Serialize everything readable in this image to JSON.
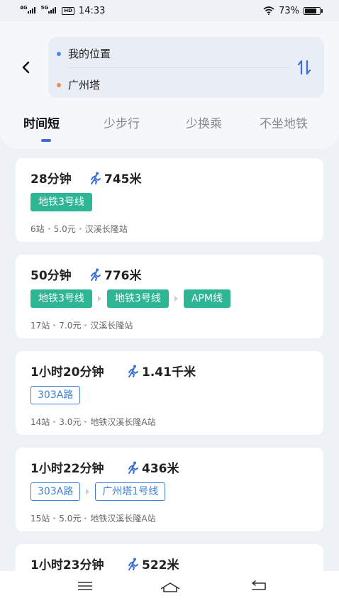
{
  "status": {
    "net1": "4G",
    "net2": "5G",
    "hd": "HD",
    "time": "14:33",
    "battery": "73%"
  },
  "route": {
    "from": "我的位置",
    "to": "广州塔"
  },
  "tabs": [
    "时间短",
    "少步行",
    "少换乘",
    "不坐地铁"
  ],
  "colors": {
    "subway_green": "#2db594",
    "bus_blue": "#3f7fd6",
    "tab_indicator": "#3a6fd8",
    "walk_icon": "#3a6fd8"
  },
  "plans": [
    {
      "time": "28分钟",
      "walk": "745米",
      "lines": [
        {
          "type": "subway",
          "name": "地铁3号线"
        }
      ],
      "stops": "6站",
      "price": "5.0元",
      "station": "汉溪长隆站"
    },
    {
      "time": "50分钟",
      "walk": "776米",
      "lines": [
        {
          "type": "subway",
          "name": "地铁3号线"
        },
        {
          "type": "subway",
          "name": "地铁3号线"
        },
        {
          "type": "subway",
          "name": "APM线"
        }
      ],
      "stops": "17站",
      "price": "7.0元",
      "station": "汉溪长隆站"
    },
    {
      "time": "1小时20分钟",
      "walk": "1.41千米",
      "lines": [
        {
          "type": "bus",
          "name": "303A路"
        }
      ],
      "stops": "14站",
      "price": "3.0元",
      "station": "地铁汉溪长隆A站"
    },
    {
      "time": "1小时22分钟",
      "walk": "436米",
      "lines": [
        {
          "type": "bus",
          "name": "303A路"
        },
        {
          "type": "bus",
          "name": "广州塔1号线"
        }
      ],
      "stops": "15站",
      "price": "5.0元",
      "station": "地铁汉溪长隆A站"
    },
    {
      "time": "1小时23分钟",
      "walk": "522米"
    }
  ]
}
